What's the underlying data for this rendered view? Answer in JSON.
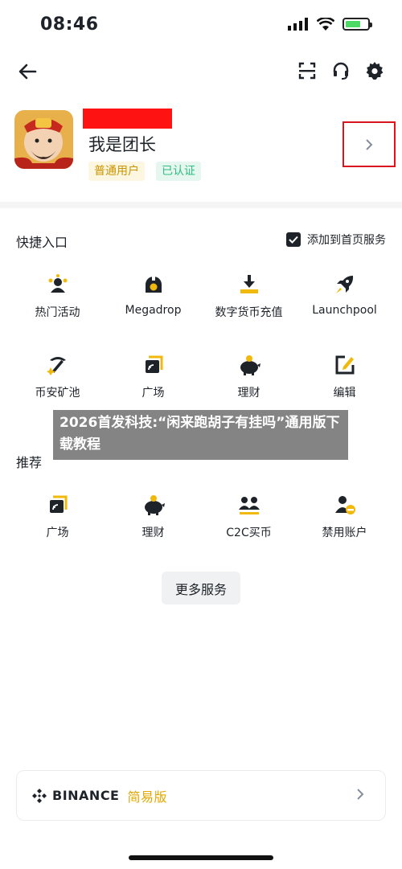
{
  "status_bar": {
    "time": "08:46"
  },
  "profile": {
    "username": "我是团长",
    "badges": [
      "普通用户",
      "已认证"
    ]
  },
  "shortcuts": {
    "title": "快捷入口",
    "add_home_label": "添加到首页服务",
    "items": [
      {
        "label": "热门活动",
        "icon": "hot-activity-icon"
      },
      {
        "label": "Megadrop",
        "icon": "megadrop-icon"
      },
      {
        "label": "数字货币充值",
        "icon": "deposit-icon"
      },
      {
        "label": "Launchpool",
        "icon": "rocket-icon"
      },
      {
        "label": "币安矿池",
        "icon": "pickaxe-icon"
      },
      {
        "label": "广场",
        "icon": "square-icon"
      },
      {
        "label": "理财",
        "icon": "piggy-bank-icon"
      },
      {
        "label": "编辑",
        "icon": "edit-icon"
      }
    ]
  },
  "recommend": {
    "title": "推荐",
    "items": [
      {
        "label": "广场",
        "icon": "square-icon"
      },
      {
        "label": "理财",
        "icon": "piggy-bank-icon"
      },
      {
        "label": "C2C买币",
        "icon": "c2c-icon"
      },
      {
        "label": "禁用账户",
        "icon": "disable-account-icon"
      }
    ]
  },
  "more_services_label": "更多服务",
  "binance_card": {
    "brand": "BINANCE",
    "mode": "简易版"
  },
  "overlay": {
    "text": "2026首发科技:“闲来跑胡子有挂吗”通用版下载教程"
  },
  "colors": {
    "accent": "#fcd535",
    "verified": "#2ebd85",
    "highlight_box": "#d9141e",
    "redaction": "#ff1212"
  }
}
